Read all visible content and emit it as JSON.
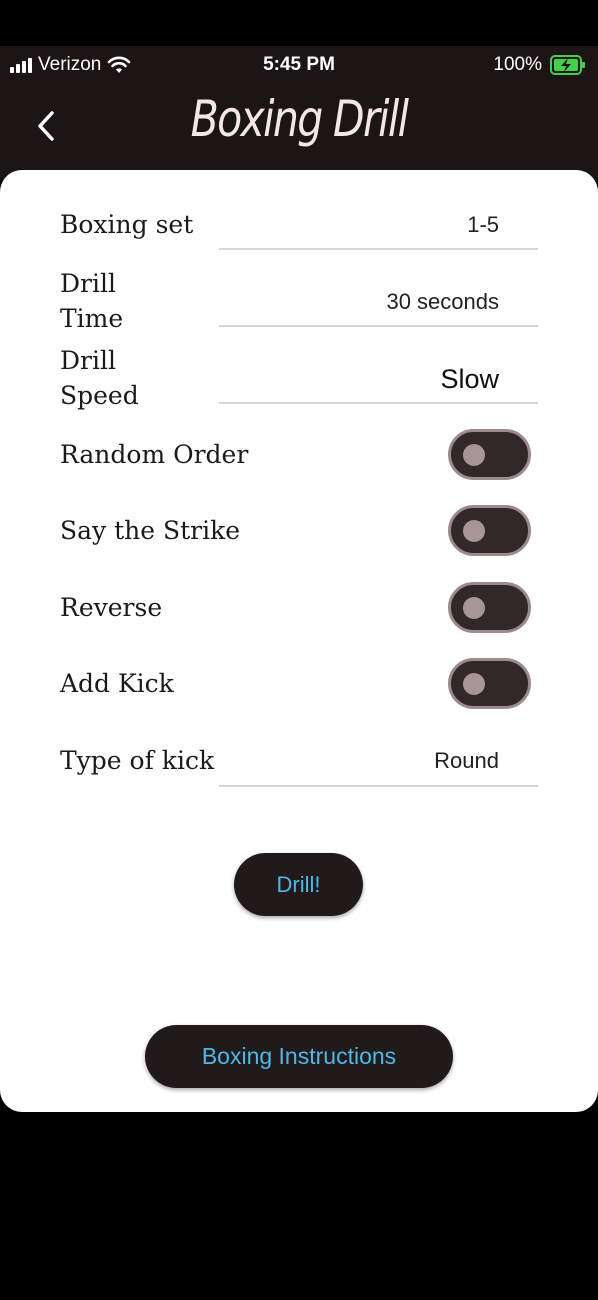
{
  "status_bar": {
    "carrier": "Verizon",
    "time": "5:45 PM",
    "battery": "100%"
  },
  "nav": {
    "title": "Boxing Drill"
  },
  "settings": {
    "boxing_set": {
      "label": "Boxing set",
      "value": "1-5"
    },
    "drill_time": {
      "label_line1": "Drill",
      "label_line2": "Time",
      "value": "30 seconds"
    },
    "drill_speed": {
      "label_line1": "Drill",
      "label_line2": "Speed",
      "value": "Slow"
    },
    "random_order": {
      "label": "Random Order",
      "on": false
    },
    "say_strike": {
      "label": "Say the Strike",
      "on": false
    },
    "reverse": {
      "label": "Reverse",
      "on": false
    },
    "add_kick": {
      "label": "Add Kick",
      "on": false
    },
    "kick_type": {
      "label": "Type of kick",
      "value": "Round"
    }
  },
  "buttons": {
    "drill": "Drill!",
    "instructions": "Boxing Instructions"
  },
  "colors": {
    "bar_background": "#1c1516",
    "title_text": "#f5e6e8",
    "button_background": "#201a1b",
    "button_text": "#4fb8e8",
    "toggle_track": "#322729",
    "toggle_knob": "#a89597",
    "battery_charge": "#44d04a"
  }
}
